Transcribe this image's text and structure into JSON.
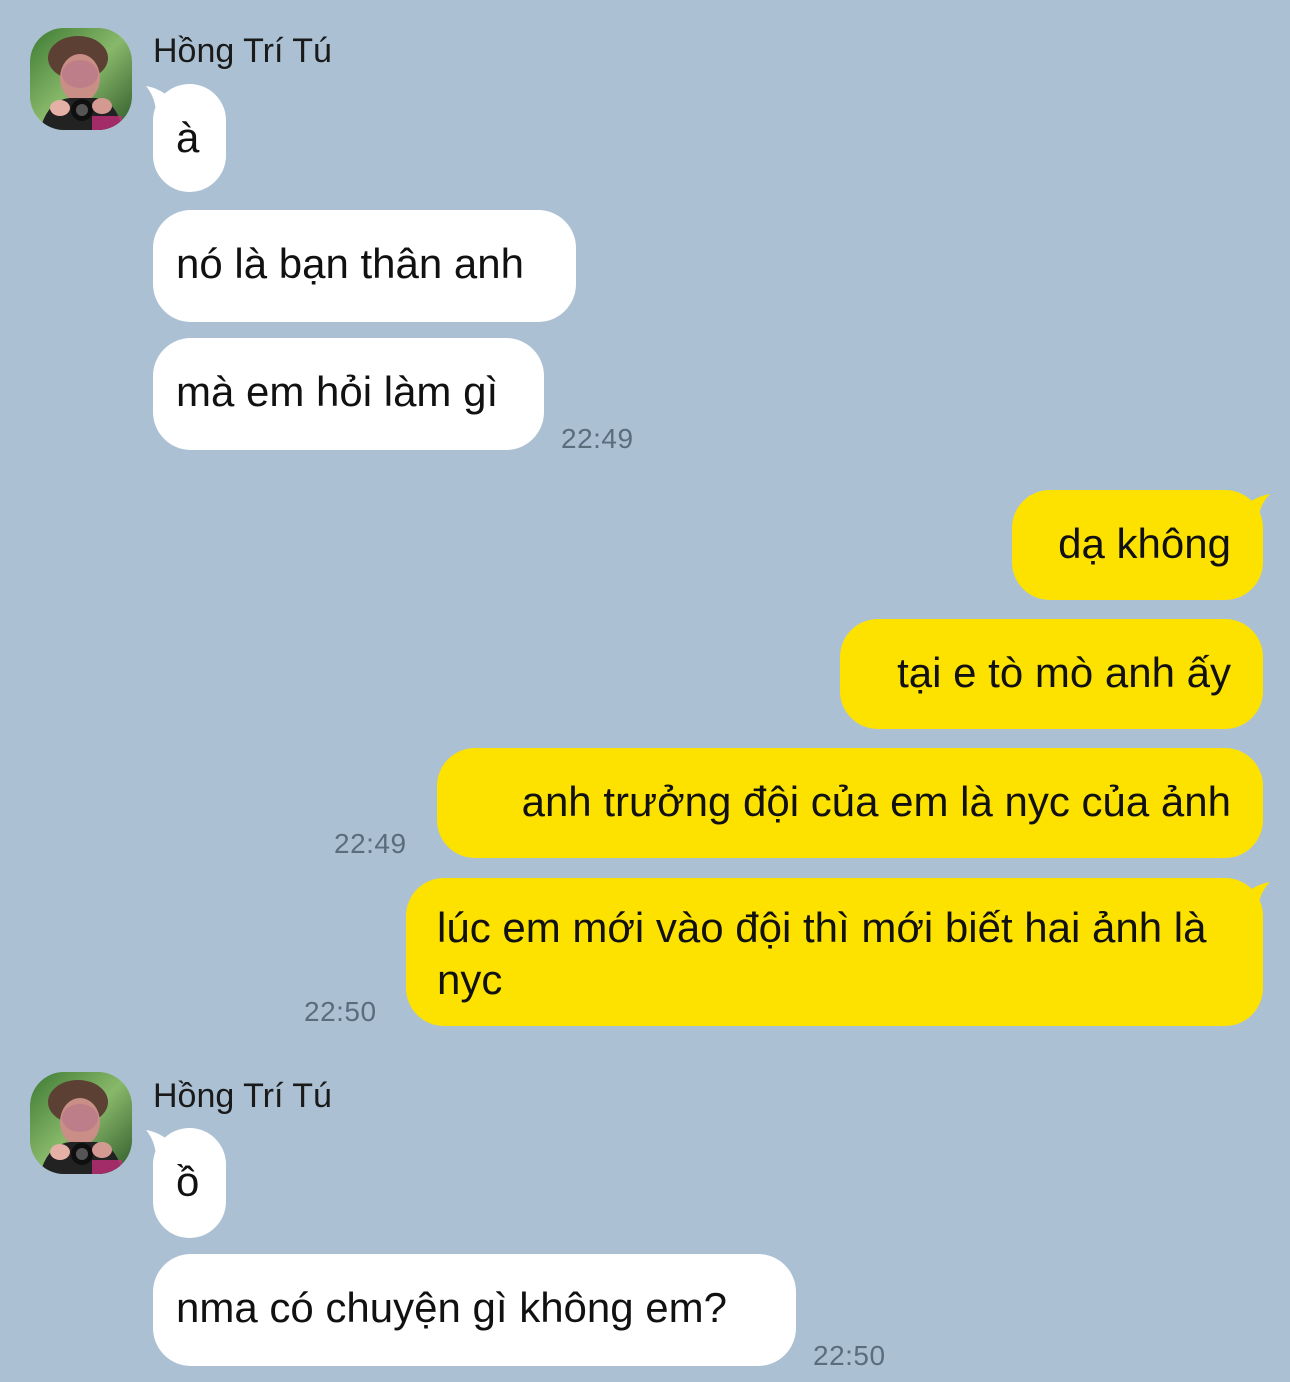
{
  "colors": {
    "background": "#abc1d3",
    "incoming_bubble": "#ffffff",
    "outgoing_bubble": "#fde200",
    "timestamp": "#5b6d7d"
  },
  "groups": [
    {
      "sender": "Hồng Trí Tú",
      "avatar": "profile-photo",
      "messages": [
        "à",
        "nó là bạn thân anh",
        "mà em hỏi làm gì"
      ],
      "time": "22:49"
    },
    {
      "sender": "me",
      "messages": [
        "dạ không",
        "tại e tò mò anh ấy",
        "anh trưởng đội của em là nyc của ảnh"
      ],
      "time": "22:49"
    },
    {
      "sender": "me",
      "messages": [
        "lúc em mới vào đội thì mới biết hai ảnh là nyc"
      ],
      "time": "22:50"
    },
    {
      "sender": "Hồng Trí Tú",
      "avatar": "profile-photo",
      "messages": [
        "ồ",
        "nma có chuyện gì không em?"
      ],
      "time": "22:50"
    }
  ]
}
